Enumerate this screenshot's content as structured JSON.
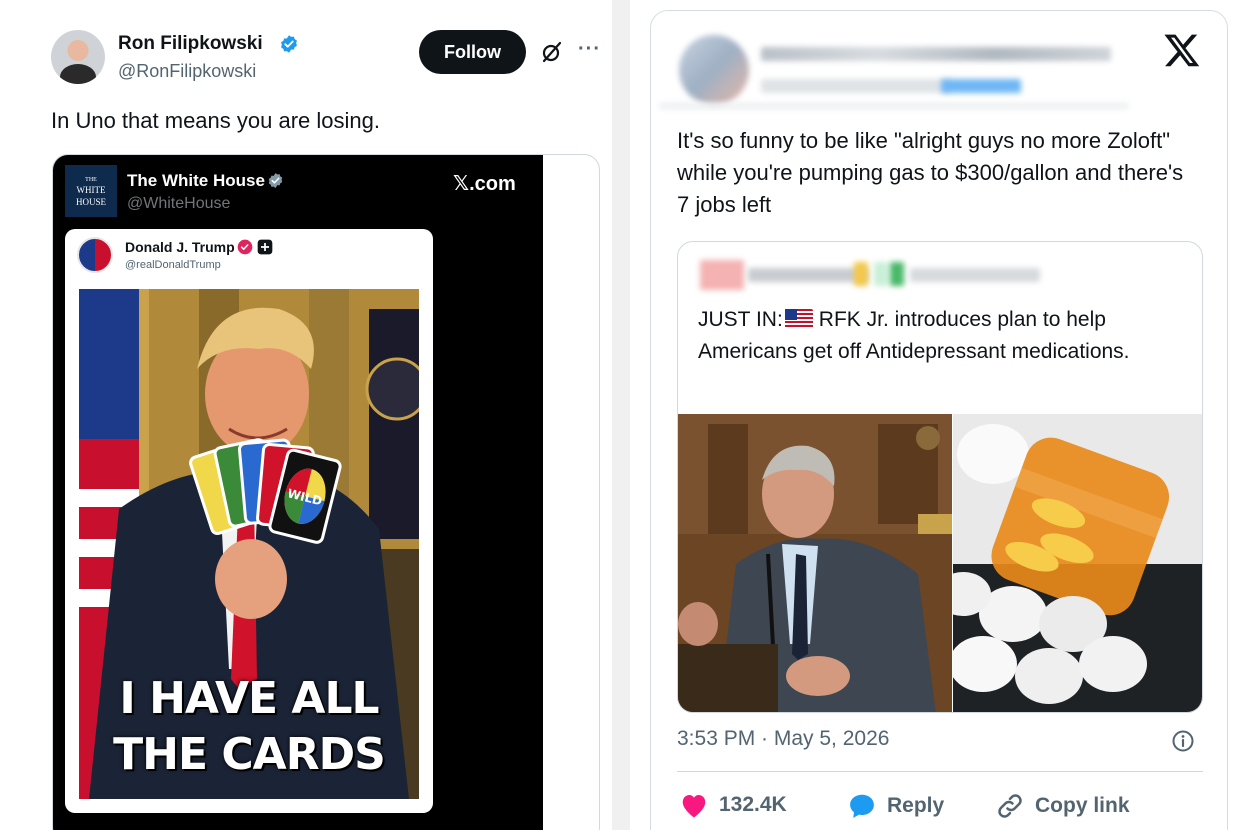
{
  "left_post": {
    "author_name": "Ron Filipkowski",
    "author_handle": "@RonFilipkowski",
    "follow_label": "Follow",
    "more_label": "···",
    "text": "In Uno that means you are losing.",
    "embed": {
      "account_name": "The White House",
      "account_handle": "@WhiteHouse",
      "logo_text_line1": "THE",
      "logo_text_line2": "WHITE",
      "logo_text_line3": "HOUSE",
      "source_label": "𝕏.com",
      "inner": {
        "author_name": "Donald J. Trump",
        "author_handle": "@realDonaldTrump",
        "caption_line1": "I HAVE ALL",
        "caption_line2": "THE CARDS",
        "card_label": "WILD"
      }
    }
  },
  "right_post": {
    "text": "It's so funny to be like \"alright guys no more Zoloft\" while you're pumping gas to $300/gallon and there's 7 jobs left",
    "quote": {
      "text_prefix": "JUST IN:",
      "text_body": "RFK Jr. introduces plan to help Americans get off Antidepressant medications."
    },
    "timestamp": "3:53 PM · May 5, 2026",
    "actions": {
      "like_count": "132.4K",
      "reply_label": "Reply",
      "copy_label": "Copy link"
    }
  },
  "colors": {
    "verified_blue": "#1d9bf0",
    "like_pink": "#f91880",
    "reply_blue": "#1d9bf0",
    "text_dark": "#0f1419",
    "text_gray": "#536471"
  }
}
